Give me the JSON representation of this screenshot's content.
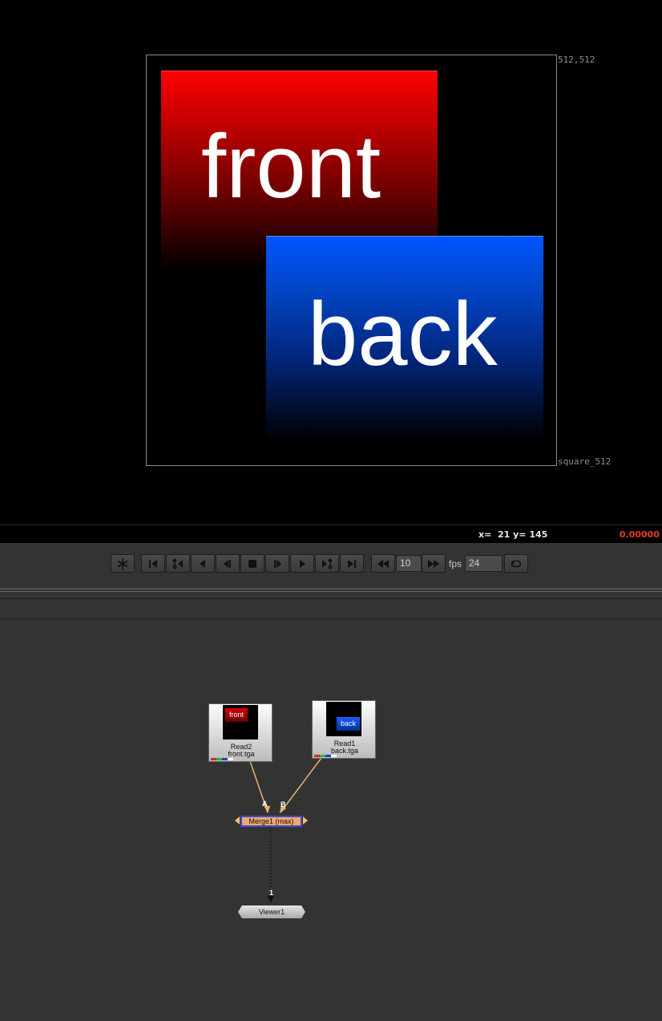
{
  "viewer": {
    "format_top_right": "512,512",
    "format_bottom_right": "square_512",
    "front_text": "front",
    "back_text": "back"
  },
  "infobar": {
    "coords": "x=  21 y= 145",
    "value": "0.00000"
  },
  "transport": {
    "increment_value": "10",
    "fps_label": "fps",
    "fps_value": "24",
    "buttons": [
      "freeze-icon",
      "first-frame-icon",
      "previous-keyframe-icon",
      "play-backward-icon",
      "step-back-icon",
      "stop-icon",
      "step-forward-icon",
      "play-forward-icon",
      "next-keyframe-icon",
      "last-frame-icon",
      "skip-back-icon",
      "skip-forward-icon",
      "loop-icon"
    ]
  },
  "nodes": {
    "read2": {
      "name": "Read2",
      "file": "front.tga",
      "thumb_text": "front"
    },
    "read1": {
      "name": "Read1",
      "file": "back.tga",
      "thumb_text": "back"
    },
    "merge": {
      "name": "Merge1 (max)",
      "input_a": "A",
      "input_b": "B"
    },
    "viewer": {
      "name": "Viewer1",
      "input": "1"
    }
  },
  "colors": {
    "accent_red": "#e23b2b",
    "merge_fill": "#f2a86b",
    "selected_border": "#3b4fcf",
    "pipe": "#f0b070"
  }
}
